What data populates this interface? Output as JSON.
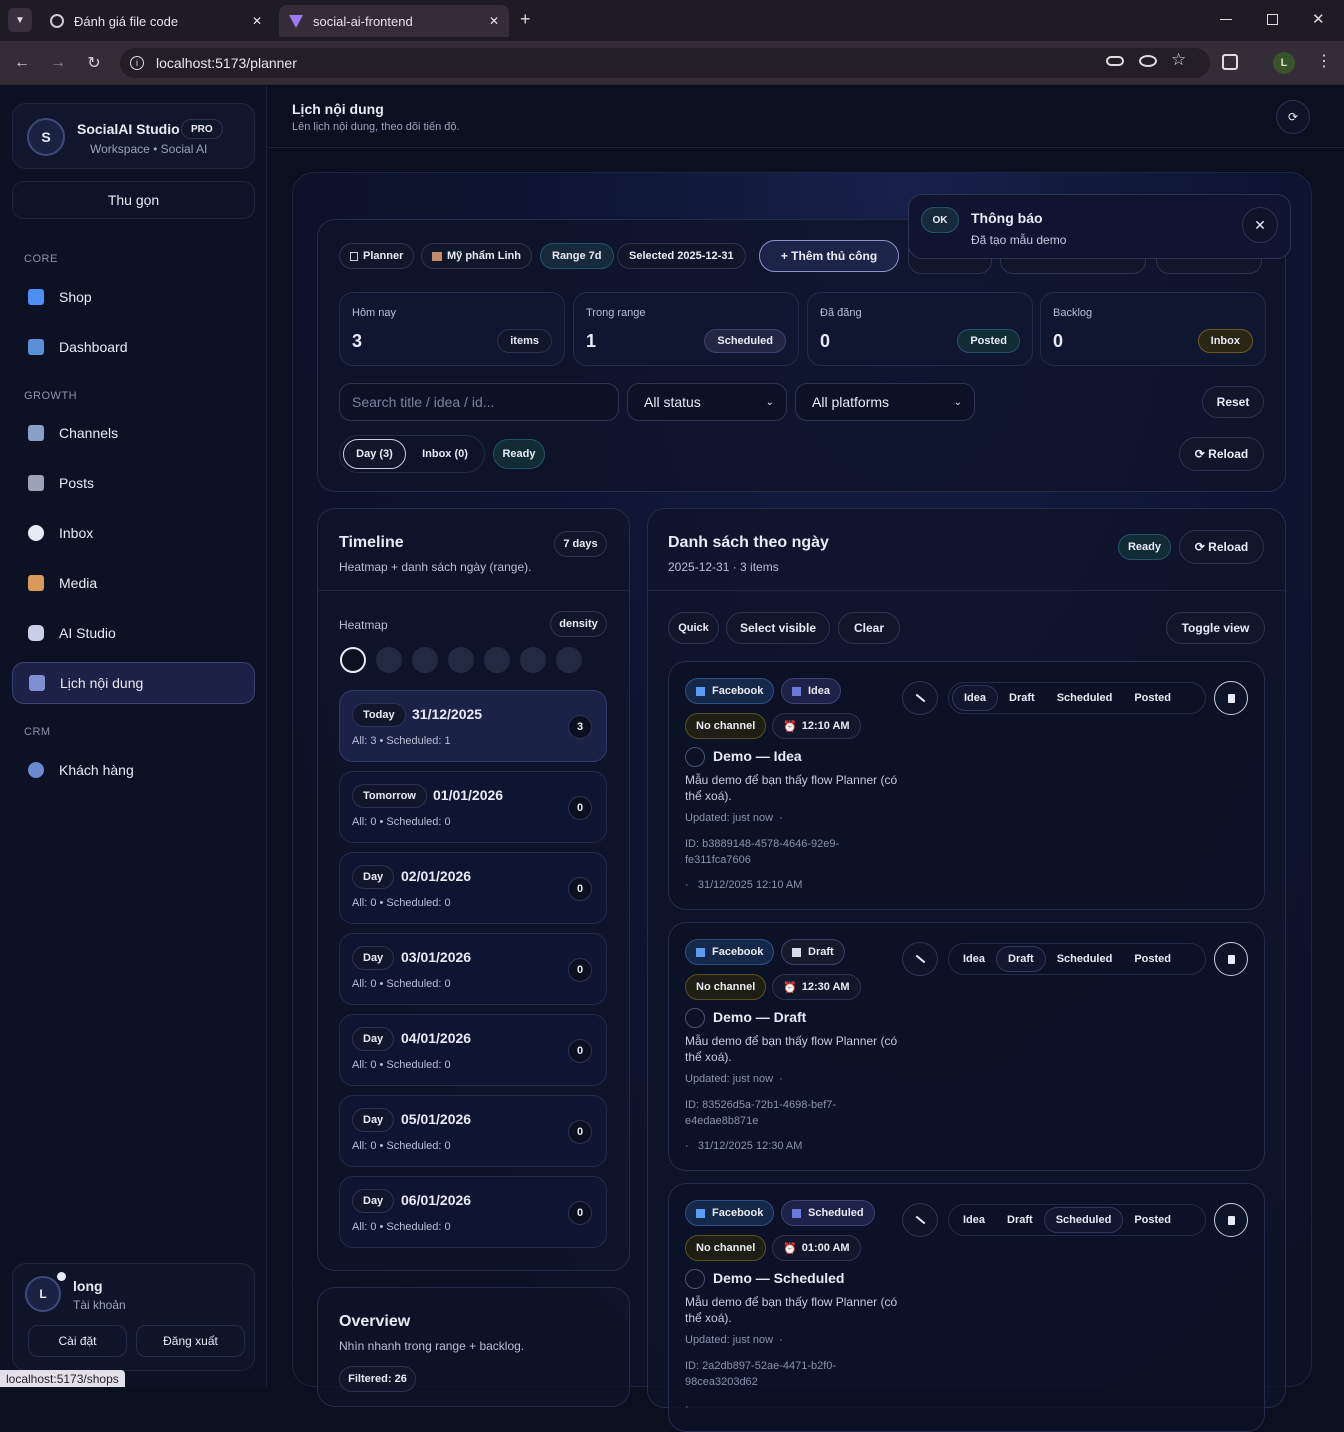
{
  "browser": {
    "tabs": [
      {
        "title": "Đánh giá file code"
      },
      {
        "title": "social-ai-frontend"
      }
    ],
    "url": "localhost:5173/planner",
    "profile_initial": "L",
    "status_url": "localhost:5173/shops"
  },
  "sidebar": {
    "brand_initial": "S",
    "brand_name": "SocialAI Studio",
    "brand_badge": "PRO",
    "brand_sub": "Workspace • Social AI",
    "collapse_label": "Thu gọn",
    "sections": {
      "core": "CORE",
      "growth": "GROWTH",
      "crm": "CRM"
    },
    "items": [
      {
        "label": "Shop",
        "icon": "shop-icon",
        "color": "#4c8df6"
      },
      {
        "label": "Dashboard",
        "icon": "chart-icon",
        "color": "#5b8fd6"
      },
      {
        "label": "Channels",
        "icon": "satellite-icon",
        "color": "#8aa0c8"
      },
      {
        "label": "Posts",
        "icon": "document-icon",
        "color": "#9aa3b8"
      },
      {
        "label": "Inbox",
        "icon": "chat-icon",
        "color": "#e8ebf5"
      },
      {
        "label": "Media",
        "icon": "picture-icon",
        "color": "#d89a5a"
      },
      {
        "label": "AI Studio",
        "icon": "robot-icon",
        "color": "#c8d0e8"
      },
      {
        "label": "Lịch nội dung",
        "icon": "calendar-icon",
        "color": "#7f8fd0"
      },
      {
        "label": "Khách hàng",
        "icon": "users-icon",
        "color": "#6a8ad0"
      }
    ],
    "user": {
      "initial": "L",
      "name": "long",
      "role": "Tài khoản",
      "settings": "Cài đặt",
      "logout": "Đăng xuất"
    }
  },
  "header": {
    "title": "Lịch nội dung",
    "subtitle": "Lên lịch nội dung, theo dõi tiến độ."
  },
  "toast": {
    "badge": "OK",
    "title": "Thông báo",
    "message": "Đã tạo mẫu demo"
  },
  "toolbar": {
    "chips": [
      "Planner",
      "Mỹ phẩm Linh",
      "Range 7d",
      "Selected 2025-12-31"
    ],
    "add_button": "+ Thêm thủ công"
  },
  "stats": [
    {
      "label": "Hôm nay",
      "value": "3",
      "tag": "items"
    },
    {
      "label": "Trong range",
      "value": "1",
      "tag": "Scheduled"
    },
    {
      "label": "Đã đăng",
      "value": "0",
      "tag": "Posted"
    },
    {
      "label": "Backlog",
      "value": "0",
      "tag": "Inbox"
    }
  ],
  "filters": {
    "search_placeholder": "Search title / idea / id...",
    "status": "All status",
    "platform": "All platforms",
    "reset": "Reset",
    "tabs": [
      "Day (3)",
      "Inbox (0)"
    ],
    "ready": "Ready",
    "reload": "⟳ Reload"
  },
  "timeline": {
    "title": "Timeline",
    "badge": "7 days",
    "subtitle": "Heatmap + danh sách ngày (range).",
    "heatmap_label": "Heatmap",
    "density": "density",
    "days": [
      {
        "tag": "Today",
        "date": "31/12/2025",
        "sub": "All: 3 • Scheduled: 1",
        "count": "3"
      },
      {
        "tag": "Tomorrow",
        "date": "01/01/2026",
        "sub": "All: 0 • Scheduled: 0",
        "count": "0"
      },
      {
        "tag": "Day",
        "date": "02/01/2026",
        "sub": "All: 0 • Scheduled: 0",
        "count": "0"
      },
      {
        "tag": "Day",
        "date": "03/01/2026",
        "sub": "All: 0 • Scheduled: 0",
        "count": "0"
      },
      {
        "tag": "Day",
        "date": "04/01/2026",
        "sub": "All: 0 • Scheduled: 0",
        "count": "0"
      },
      {
        "tag": "Day",
        "date": "05/01/2026",
        "sub": "All: 0 • Scheduled: 0",
        "count": "0"
      },
      {
        "tag": "Day",
        "date": "06/01/2026",
        "sub": "All: 0 • Scheduled: 0",
        "count": "0"
      }
    ]
  },
  "overview": {
    "title": "Overview",
    "subtitle": "Nhìn nhanh trong range + backlog.",
    "filtered": "Filtered: 26"
  },
  "daylist": {
    "title": "Danh sách theo ngày",
    "subtitle": "2025-12-31 · 3 items",
    "ready": "Ready",
    "reload": "⟳ Reload",
    "actions": {
      "quick": "Quick",
      "select_visible": "Select visible",
      "clear": "Clear",
      "toggle_view": "Toggle view"
    },
    "segments": [
      "Idea",
      "Draft",
      "Scheduled",
      "Posted"
    ],
    "posts": [
      {
        "platform": "Facebook",
        "status": "Idea",
        "channel": "No channel",
        "time": "12:10 AM",
        "title": "Demo — Idea",
        "desc": "Mẫu demo để bạn thấy flow Planner (có thể xoá).",
        "updated": "Updated: just now",
        "id": "ID: b3889148-4578-4646-92e9-fe311fca7606",
        "datetime": "31/12/2025 12:10 AM",
        "active": 0
      },
      {
        "platform": "Facebook",
        "status": "Draft",
        "channel": "No channel",
        "time": "12:30 AM",
        "title": "Demo — Draft",
        "desc": "Mẫu demo để bạn thấy flow Planner (có thể xoá).",
        "updated": "Updated: just now",
        "id": "ID: 83526d5a-72b1-4698-bef7-e4edae8b871e",
        "datetime": "31/12/2025 12:30 AM",
        "active": 1
      },
      {
        "platform": "Facebook",
        "status": "Scheduled",
        "channel": "No channel",
        "time": "01:00 AM",
        "title": "Demo — Scheduled",
        "desc": "Mẫu demo để bạn thấy flow Planner (có thể xoá).",
        "updated": "Updated: just now",
        "id": "ID: 2a2db897-52ae-4471-b2f0-98cea3203d62",
        "datetime": "",
        "active": 2
      }
    ]
  }
}
